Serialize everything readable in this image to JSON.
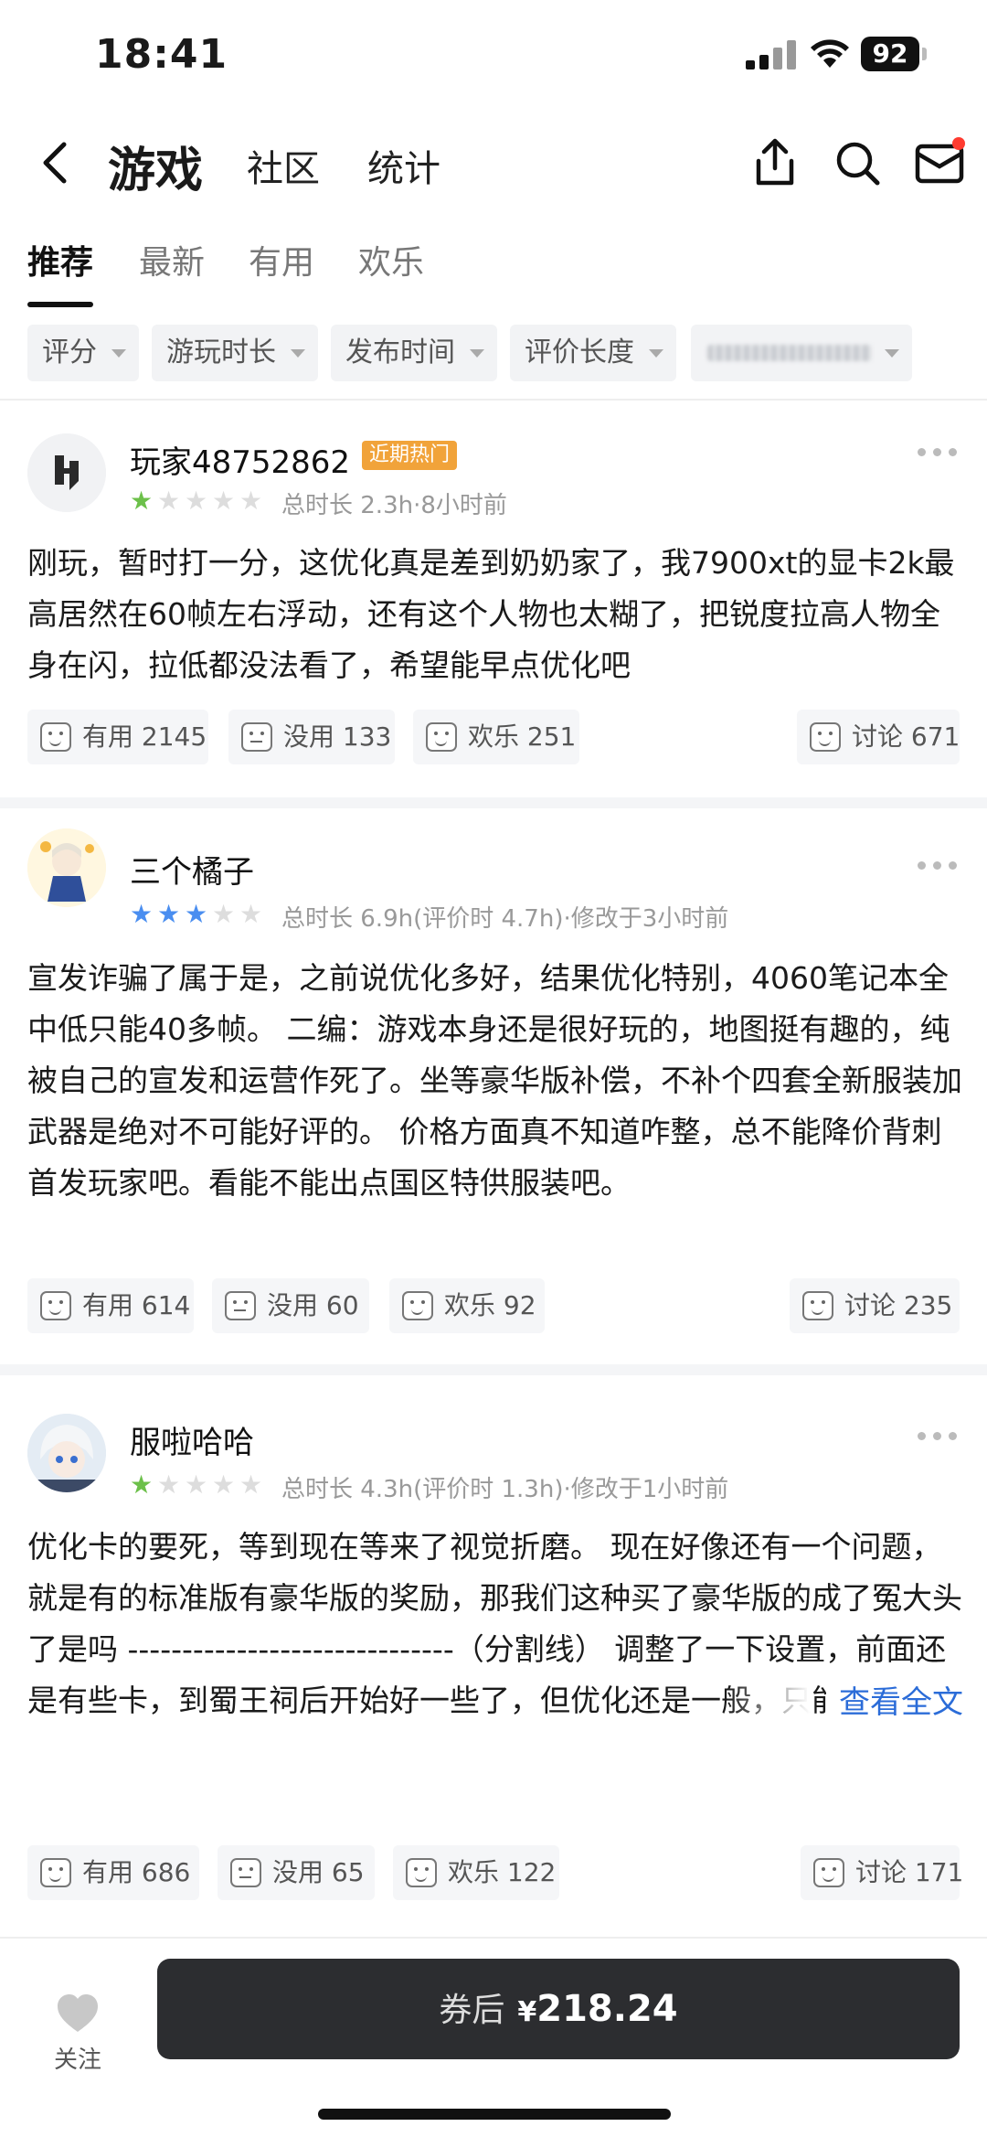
{
  "status": {
    "time": "18:41",
    "battery": "92"
  },
  "nav": {
    "title": "游戏",
    "tabs": [
      "社区",
      "统计"
    ]
  },
  "tabs": [
    "推荐",
    "最新",
    "有用",
    "欢乐"
  ],
  "filters": [
    "评分",
    "游玩时长",
    "发布时间",
    "评价长度"
  ],
  "reviews": [
    {
      "name": "玩家48752862",
      "badge": "近期热门",
      "stars": 1,
      "meta": "总时长 2.3h·8小时前",
      "text": "刚玩，暂时打一分，这优化真是差到奶奶家了，我7900xt的显卡2k最高居然在60帧左右浮动，还有这个人物也太糊了，把锐度拉高人物全身在闪，拉低都没法看了，希望能早点优化吧",
      "useful": "有用 2145",
      "useless": "没用 133",
      "fun": "欢乐 251",
      "discuss": "讨论 671"
    },
    {
      "name": "三个橘子",
      "stars": 3,
      "meta": "总时长 6.9h(评价时 4.7h)·修改于3小时前",
      "text": "宣发诈骗了属于是，之前说优化多好，结果优化特别，4060笔记本全中低只能40多帧。 二编：游戏本身还是很好玩的，地图挺有趣的，纯被自己的宣发和运营作死了。坐等豪华版补偿，不补个四套全新服装加武器是绝对不可能好评的。 价格方面真不知道咋整，总不能降价背刺首发玩家吧。看能不能出点国区特供服装吧。",
      "useful": "有用 614",
      "useless": "没用 60",
      "fun": "欢乐 92",
      "discuss": "讨论 235"
    },
    {
      "name": "服啦哈哈",
      "stars": 1,
      "meta": "总时长 4.3h(评价时 1.3h)·修改于1小时前",
      "text": "优化卡的要死，等到现在等来了视觉折磨。 现在好像还有一个问题，就是有的标准版有豪华版的奖励，那我们这种买了豪华版的成了冤大头了是吗 ------------------------------（分割线） 调整了一下设置，前面还是有些卡，到蜀王祠后开始好一些了，但优化还是一般，只能说能玩了，不像刚进去时卡的飞起；官方到现在还在装死，qq群里发话，但正式平台还没说",
      "readmore": "查看全文",
      "useful": "有用 686",
      "useless": "没用 65",
      "fun": "欢乐 122",
      "discuss": "讨论 171"
    }
  ],
  "bottom": {
    "follow": "关注",
    "price_prefix": "券后",
    "currency": "¥",
    "price": "218.24"
  },
  "colors": {
    "accent_link": "#2b6cd8",
    "badge": "#f1a33a",
    "star_green": "#6cc04a",
    "star_blue": "#4a8ef0",
    "buy_button": "#2c2d30"
  }
}
